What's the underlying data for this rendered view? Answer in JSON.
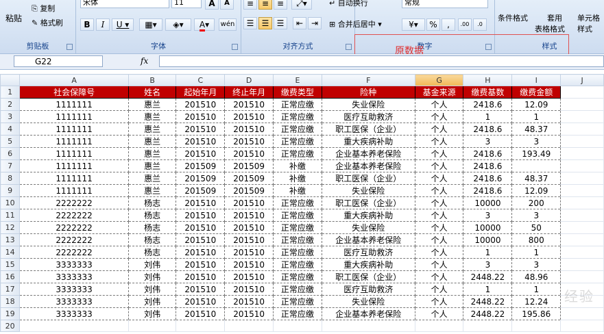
{
  "ribbon": {
    "clipboard": {
      "paste": "粘贴",
      "copy": "复制",
      "format_painter": "格式刷",
      "group": "剪贴板"
    },
    "font": {
      "font_name": "宋体",
      "font_size": "11",
      "group": "字体"
    },
    "alignment": {
      "wrap": "自动换行",
      "merge": "合并后居中",
      "group": "对齐方式"
    },
    "number": {
      "format": "常规",
      "group": "数字"
    },
    "styles": {
      "cond": "条件格式",
      "table": "套用",
      "table2": "表格格式",
      "cell": "单元格",
      "cell2": "样式",
      "group": "样式"
    }
  },
  "formula_bar": {
    "name_box": "G22",
    "fx": "fx",
    "value": ""
  },
  "annotation": "原数据",
  "col_headers": [
    "A",
    "B",
    "C",
    "D",
    "E",
    "F",
    "G",
    "H",
    "I",
    "J"
  ],
  "header_row": [
    "社会保障号",
    "姓名",
    "起始年月",
    "终止年月",
    "缴费类型",
    "险种",
    "基金来源",
    "缴费基数",
    "缴费金额"
  ],
  "rows": [
    [
      "1111111",
      "惠兰",
      "201510",
      "201510",
      "正常应缴",
      "失业保险",
      "个人",
      "2418.6",
      "12.09"
    ],
    [
      "1111111",
      "惠兰",
      "201510",
      "201510",
      "正常应缴",
      "医疗互助救济",
      "个人",
      "1",
      "1"
    ],
    [
      "1111111",
      "惠兰",
      "201510",
      "201510",
      "正常应缴",
      "职工医保（企业）",
      "个人",
      "2418.6",
      "48.37"
    ],
    [
      "1111111",
      "惠兰",
      "201510",
      "201510",
      "正常应缴",
      "重大疾病补助",
      "个人",
      "3",
      "3"
    ],
    [
      "1111111",
      "惠兰",
      "201510",
      "201510",
      "正常应缴",
      "企业基本养老保险",
      "个人",
      "2418.6",
      "193.49"
    ],
    [
      "1111111",
      "惠兰",
      "201509",
      "201509",
      "补缴",
      "企业基本养老保险",
      "个人",
      "2418.6",
      ""
    ],
    [
      "1111111",
      "惠兰",
      "201509",
      "201509",
      "补缴",
      "职工医保（企业）",
      "个人",
      "2418.6",
      "48.37"
    ],
    [
      "1111111",
      "惠兰",
      "201509",
      "201509",
      "补缴",
      "失业保险",
      "个人",
      "2418.6",
      "12.09"
    ],
    [
      "2222222",
      "杨志",
      "201510",
      "201510",
      "正常应缴",
      "职工医保（企业）",
      "个人",
      "10000",
      "200"
    ],
    [
      "2222222",
      "杨志",
      "201510",
      "201510",
      "正常应缴",
      "重大疾病补助",
      "个人",
      "3",
      "3"
    ],
    [
      "2222222",
      "杨志",
      "201510",
      "201510",
      "正常应缴",
      "失业保险",
      "个人",
      "10000",
      "50"
    ],
    [
      "2222222",
      "杨志",
      "201510",
      "201510",
      "正常应缴",
      "企业基本养老保险",
      "个人",
      "10000",
      "800"
    ],
    [
      "2222222",
      "杨志",
      "201510",
      "201510",
      "正常应缴",
      "医疗互助救济",
      "个人",
      "1",
      "1"
    ],
    [
      "3333333",
      "刘伟",
      "201510",
      "201510",
      "正常应缴",
      "重大疾病补助",
      "个人",
      "3",
      "3"
    ],
    [
      "3333333",
      "刘伟",
      "201510",
      "201510",
      "正常应缴",
      "职工医保（企业）",
      "个人",
      "2448.22",
      "48.96"
    ],
    [
      "3333333",
      "刘伟",
      "201510",
      "201510",
      "正常应缴",
      "医疗互助救济",
      "个人",
      "1",
      "1"
    ],
    [
      "3333333",
      "刘伟",
      "201510",
      "201510",
      "正常应缴",
      "失业保险",
      "个人",
      "2448.22",
      "12.24"
    ],
    [
      "3333333",
      "刘伟",
      "201510",
      "201510",
      "正常应缴",
      "企业基本养老保险",
      "个人",
      "2448.22",
      "195.86"
    ]
  ],
  "row_numbers": [
    "1",
    "2",
    "3",
    "4",
    "5",
    "6",
    "7",
    "8",
    "9",
    "10",
    "11",
    "12",
    "13",
    "14",
    "15",
    "16",
    "17",
    "18",
    "19",
    "20"
  ]
}
